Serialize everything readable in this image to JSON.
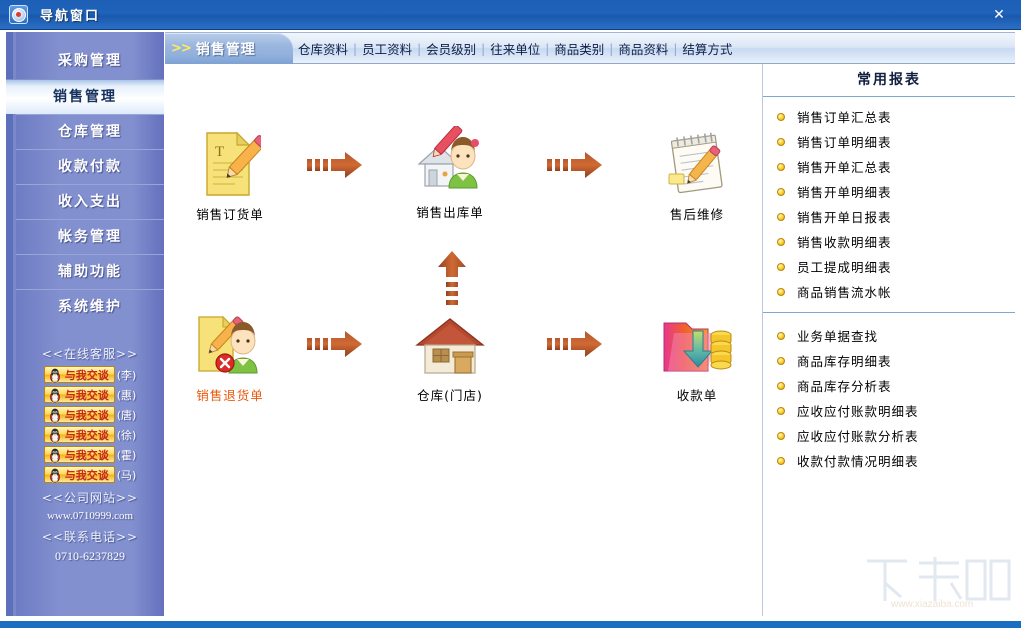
{
  "window": {
    "title": "导航窗口",
    "icon": "navigation-icon",
    "close_label": "✕"
  },
  "sidebar": {
    "items": [
      {
        "label": "采购管理",
        "active": false
      },
      {
        "label": "销售管理",
        "active": true
      },
      {
        "label": "仓库管理",
        "active": false
      },
      {
        "label": "收款付款",
        "active": false
      },
      {
        "label": "收入支出",
        "active": false
      },
      {
        "label": "帐务管理",
        "active": false
      },
      {
        "label": "辅助功能",
        "active": false
      },
      {
        "label": "系统维护",
        "active": false
      }
    ],
    "service": {
      "online_heading": "<<在线客服>>",
      "chat_label": "与我交谈",
      "agents": [
        "(李)",
        "(惠)",
        "(唐)",
        "(徐)",
        "(霍)",
        "(马)"
      ],
      "website_heading": "<<公司网站>>",
      "website": "www.0710999.com",
      "phone_heading": "<<联系电话>>",
      "phone": "0710-6237829"
    }
  },
  "tabs": {
    "active": {
      "arrows": ">>",
      "label": "销售管理"
    },
    "links": [
      "仓库资料",
      "员工资料",
      "会员级别",
      "往来单位",
      "商品类别",
      "商品资料",
      "结算方式"
    ],
    "separator": "|"
  },
  "flow": {
    "nodes": [
      {
        "id": "sales-order",
        "label": "销售订货单",
        "icon": "document-pencil-icon",
        "warn": false
      },
      {
        "id": "sales-outbound",
        "label": "销售出库单",
        "icon": "house-person-icon",
        "warn": false
      },
      {
        "id": "after-sales",
        "label": "售后维修",
        "icon": "notepad-pencil-icon",
        "warn": false
      },
      {
        "id": "sales-return",
        "label": "销售退货单",
        "icon": "document-person-x-icon",
        "warn": true
      },
      {
        "id": "warehouse-store",
        "label": "仓库(门店)",
        "icon": "house-icon",
        "warn": false
      },
      {
        "id": "receipt-voucher",
        "label": "收款单",
        "icon": "folder-money-icon",
        "warn": false
      }
    ],
    "arrows": [
      "arrow-right-icon",
      "arrow-right-icon",
      "arrow-up-icon",
      "arrow-right-icon",
      "arrow-right-icon"
    ]
  },
  "reports": {
    "title": "常用报表",
    "group1": [
      "销售订单汇总表",
      "销售订单明细表",
      "销售开单汇总表",
      "销售开单明细表",
      "销售开单日报表",
      "销售收款明细表",
      "员工提成明细表",
      "商品销售流水帐"
    ],
    "group2": [
      "业务单据查找",
      "商品库存明细表",
      "商品库存分析表",
      "应收应付账款明细表",
      "应收应付账款分析表",
      "收款付款情况明细表"
    ]
  },
  "watermark": {
    "logo": "下载吧",
    "url": "www.xiazaiba.com"
  },
  "colors": {
    "titlebar": "#1f62ba",
    "sidebar": "#8390cf",
    "accent_orange": "#e9590c",
    "bullet": "#ffd83f",
    "bottom_border": "#1c6fc0"
  }
}
